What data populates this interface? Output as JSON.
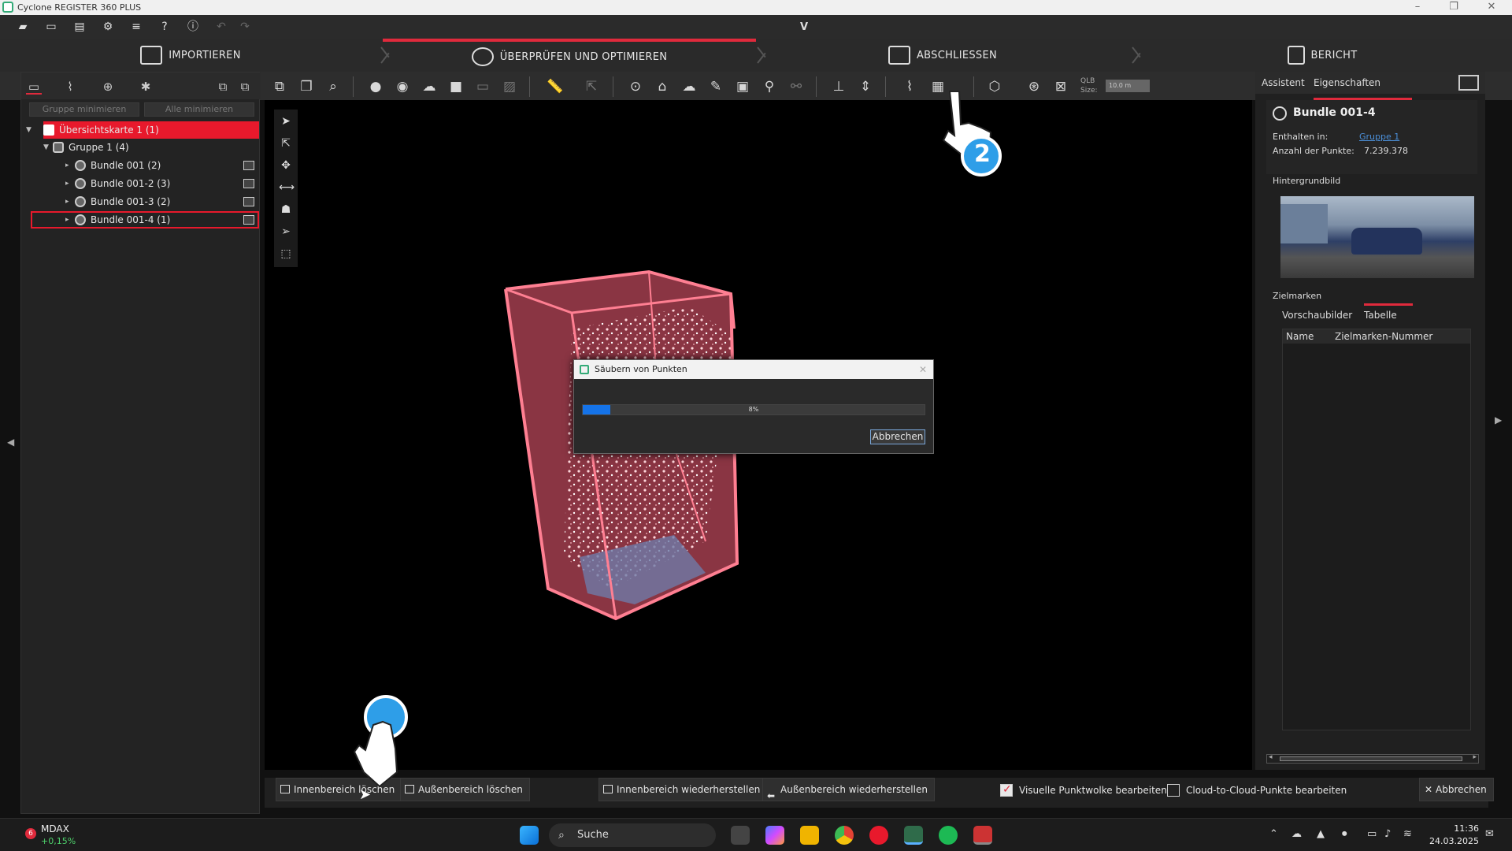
{
  "window": {
    "title": "Cyclone REGISTER 360 PLUS",
    "minimize": "–",
    "maximize": "❐",
    "close": "✕"
  },
  "quickbar": {
    "marker": "V"
  },
  "steps": [
    {
      "label": "IMPORTIEREN"
    },
    {
      "label": "ÜBERPRÜFEN UND OPTIMIEREN"
    },
    {
      "label": "ABSCHLIESSEN"
    },
    {
      "label": "BERICHT"
    }
  ],
  "toolbar": {
    "qlb_label": "QLB\nSize:",
    "qlb_value": "10.0 m"
  },
  "leftpanel": {
    "btn_minimize_group": "Gruppe minimieren",
    "btn_minimize_all": "Alle minimieren",
    "tree": [
      {
        "label": "Übersichtskarte 1 (1)"
      },
      {
        "label": "Gruppe 1 (4)"
      },
      {
        "label": "Bundle 001 (2)"
      },
      {
        "label": "Bundle 001-2 (3)"
      },
      {
        "label": "Bundle 001-3 (2)"
      },
      {
        "label": "Bundle 001-4 (1)"
      }
    ]
  },
  "dialog": {
    "title": "Säubern von Punkten",
    "progress_percent": 8,
    "progress_text": "8%",
    "cancel": "Abbrechen",
    "close": "✕"
  },
  "rightpanel": {
    "tab_assistant": "Assistent",
    "tab_properties": "Eigenschaften",
    "bundle_name": "Bundle 001-4",
    "contained_label": "Enthalten in:",
    "contained_value": "Gruppe 1",
    "points_label": "Anzahl der Punkte:",
    "points_value": "7.239.378",
    "background_label": "Hintergrundbild",
    "targets_label": "Zielmarken",
    "tab_thumbnails": "Vorschaubilder",
    "tab_table": "Tabelle",
    "col_name": "Name",
    "col_number": "Zielmarken-Nummer"
  },
  "bottombar": {
    "delete_inner": "Innenbereich löschen",
    "delete_outer": "Außenbereich löschen",
    "restore_inner": "Innenbereich wiederherstellen",
    "restore_outer": "Außenbereich wiederherstellen",
    "edit_visual": "Visuelle Punktwolke bearbeiten",
    "edit_visual_checked": true,
    "edit_c2c": "Cloud-to-Cloud-Punkte bearbeiten",
    "edit_c2c_checked": false,
    "cancel": "Abbrechen"
  },
  "annotations": {
    "step_2": "2"
  },
  "taskbar": {
    "ticker_badge": "6",
    "ticker_name": "MDAX",
    "ticker_change": "+0,15%",
    "search": "Suche",
    "time": "11:36",
    "date": "24.03.2025"
  },
  "colors": {
    "accent": "#e02a3c",
    "progress": "#1573e8",
    "selection": "#e8192c"
  },
  "icons": [
    "folder-open-icon",
    "folder-icon",
    "book-icon",
    "gear-icon",
    "database-icon",
    "help-icon",
    "info-icon",
    "undo-icon",
    "redo-icon",
    "import-icon",
    "review-icon",
    "check-icon",
    "report-icon",
    "cursor-icon",
    "hand-pointer-icon",
    "checkbox-icon",
    "search-icon",
    "windows-icon"
  ]
}
